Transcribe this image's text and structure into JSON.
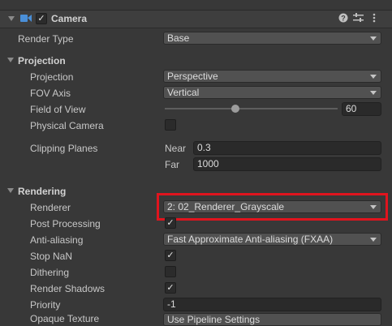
{
  "component": {
    "name": "Camera",
    "enabled_mark": "✓",
    "icons": [
      "camera-icon",
      "help-icon",
      "preset-icon",
      "more-icon"
    ]
  },
  "fields": {
    "render_type": {
      "label": "Render Type",
      "value": "Base"
    },
    "projection_section": "Projection",
    "projection": {
      "label": "Projection",
      "value": "Perspective"
    },
    "fov_axis": {
      "label": "FOV Axis",
      "value": "Vertical"
    },
    "field_of_view": {
      "label": "Field of View",
      "value": "60",
      "slider_fraction": 0.41
    },
    "physical_camera": {
      "label": "Physical Camera",
      "checked": false
    },
    "clipping_planes": {
      "label": "Clipping Planes",
      "near_label": "Near",
      "near": "0.3",
      "far_label": "Far",
      "far": "1000"
    },
    "rendering_section": "Rendering",
    "renderer": {
      "label": "Renderer",
      "value": "2: 02_Renderer_Grayscale"
    },
    "post_processing": {
      "label": "Post Processing",
      "checked": true,
      "mark": "✓"
    },
    "anti_aliasing": {
      "label": "Anti-aliasing",
      "value": "Fast Approximate Anti-aliasing (FXAA)"
    },
    "stop_nan": {
      "label": "Stop NaN",
      "checked": true,
      "mark": "✓"
    },
    "dithering": {
      "label": "Dithering",
      "checked": false
    },
    "render_shadows": {
      "label": "Render Shadows",
      "checked": true,
      "mark": "✓"
    },
    "priority": {
      "label": "Priority",
      "value": "-1"
    },
    "opaque_texture": {
      "label": "Opaque Texture",
      "value": "Use Pipeline Settings"
    }
  },
  "highlight_color": "#e0141e"
}
